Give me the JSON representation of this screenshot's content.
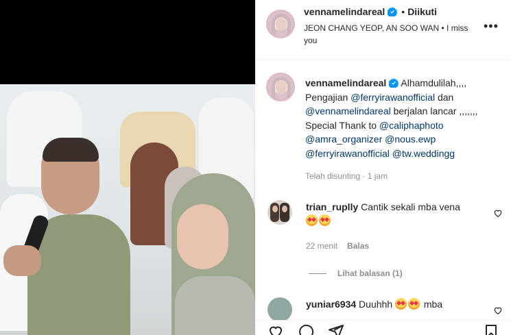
{
  "post": {
    "username": "vennamelindareal",
    "follow_status": "Diikuti",
    "location": "JEON CHANG YEOP, AN SOO WAN • I miss you",
    "more_label": "•••"
  },
  "caption": {
    "username": "vennamelindareal",
    "p1": " Alhamdulilah,,,,",
    "p2": "Pengajian ",
    "mention1": "@ferryirawanofficial",
    "p3": " dan",
    "mention2": "@vennamelindareal",
    "p4": " berjalan lancar ,,,,,,,",
    "p5": "Special Thank to ",
    "mention3": "@caliphaphoto",
    "mention4": "@amra_organizer",
    "mention5": "@nous.ewp",
    "mention6": "@ferryirawanofficial",
    "mention7": "@tw.weddingg",
    "meta": "Telah disunting · 1 jam"
  },
  "comments": [
    {
      "username": "trian_ruplly",
      "text": " Cantik sekali mba vena ",
      "time": "22 menit",
      "reply_label": "Balas",
      "view_replies": "Lihat balasan (1)"
    },
    {
      "username": "yuniar6934",
      "text": " Duuhhh ",
      "text_after": " mba"
    }
  ],
  "colors": {
    "link": "#00376b",
    "verified": "#0095f6",
    "muted": "#8e8e8e"
  },
  "icons": [
    "verified-badge-icon",
    "more-options-icon",
    "heart-icon",
    "comment-icon",
    "share-icon",
    "save-icon",
    "heart-eyes-emoji"
  ]
}
